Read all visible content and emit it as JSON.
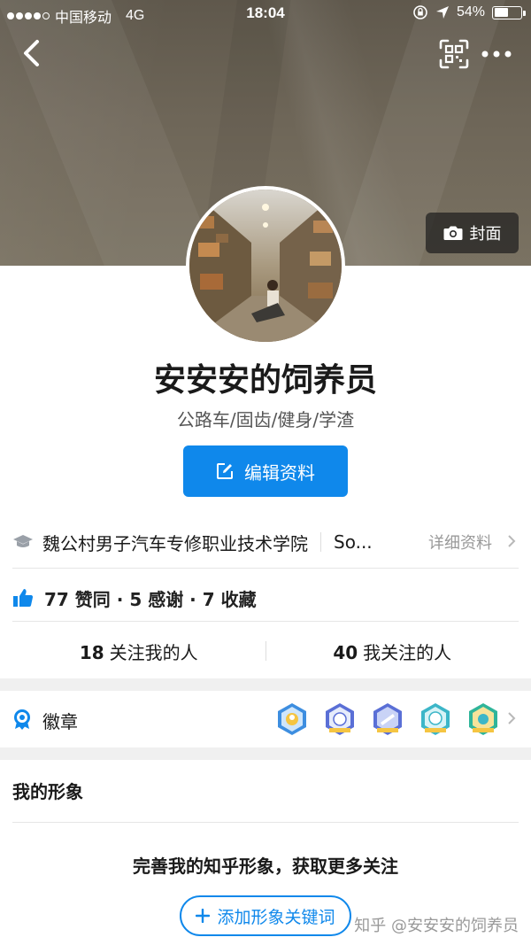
{
  "status_bar": {
    "carrier": "中国移动",
    "network": "4G",
    "time": "18:04",
    "battery": "54%",
    "battery_level": 0.54
  },
  "cover": {
    "button_label": "封面"
  },
  "profile": {
    "name": "安安安的饲养员",
    "headline": "公路车/固齿/健身/学渣",
    "edit_label": "编辑资料"
  },
  "education": {
    "school": "魏公村男子汽车专修职业技术学院",
    "company": "So...",
    "detail_label": "详细资料"
  },
  "stats": {
    "text": "77 赞同 · 5 感谢 · 7 收藏"
  },
  "follow": {
    "followers_count": "18",
    "followers_label": "关注我的人",
    "following_count": "40",
    "following_label": "我关注的人"
  },
  "badges": {
    "label": "徽章",
    "items": [
      "badge-1",
      "badge-2",
      "badge-3",
      "badge-4",
      "badge-5"
    ]
  },
  "image_section": {
    "title": "我的形象",
    "prompt": "完善我的知乎形象，获取更多关注",
    "add_label": "添加形象关键词"
  },
  "watermark": "知乎 @安安安的饲养员",
  "colors": {
    "accent": "#0f88eb",
    "divider": "#e6e6e6",
    "band": "#f0f0f0"
  }
}
